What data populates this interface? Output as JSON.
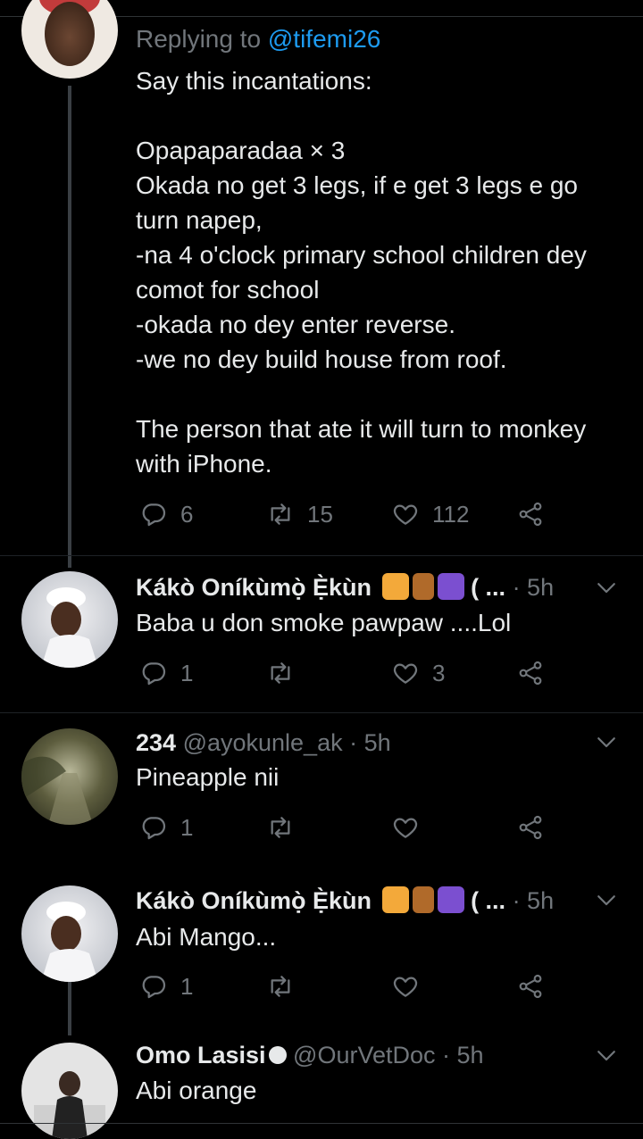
{
  "main_tweet": {
    "replying_prefix": "Replying to ",
    "replying_handle": "@tifemi26",
    "text": "Say this incantations:\n\nOpapaparadaa × 3\nOkada no get 3 legs, if e get 3 legs e go\nturn napep,\n-na 4 o'clock primary school children dey\ncomot for school\n-okada no dey enter reverse.\n-we no dey build house from roof.\n\nThe person that ate it will turn to monkey\nwith iPhone.",
    "replies": "6",
    "retweets": "15",
    "likes": "112"
  },
  "replies": [
    {
      "name": "Kákò Oníkùmọ̀ Ẹ̀kùn",
      "handle_suffix": " ( ...",
      "time": " · 5h",
      "text": "Baba u don smoke pawpaw ....Lol",
      "replies": "1",
      "retweets": "",
      "likes": "3"
    },
    {
      "name": "234",
      "handle_suffix": " @ayokunle_ak",
      "time": " · 5h",
      "text": "Pineapple nii",
      "replies": "1",
      "retweets": "",
      "likes": ""
    },
    {
      "name": "Kákò Oníkùmọ̀ Ẹ̀kùn",
      "handle_suffix": " ( ...",
      "time": " · 5h",
      "text": "Abi Mango...",
      "replies": "1",
      "retweets": "",
      "likes": ""
    },
    {
      "name": "Omo Lasisi",
      "handle_suffix": " @OurVetDoc",
      "time": " · 5h",
      "text": "Abi orange"
    }
  ],
  "colors": {
    "background": "#000000",
    "text": "#e7e9ea",
    "muted": "#71767b",
    "link": "#1d9bf0"
  },
  "icons": [
    "reply-icon",
    "retweet-icon",
    "like-icon",
    "share-icon",
    "chevron-down-icon",
    "lion-emoji",
    "pick-emoji",
    "aries-emoji"
  ]
}
